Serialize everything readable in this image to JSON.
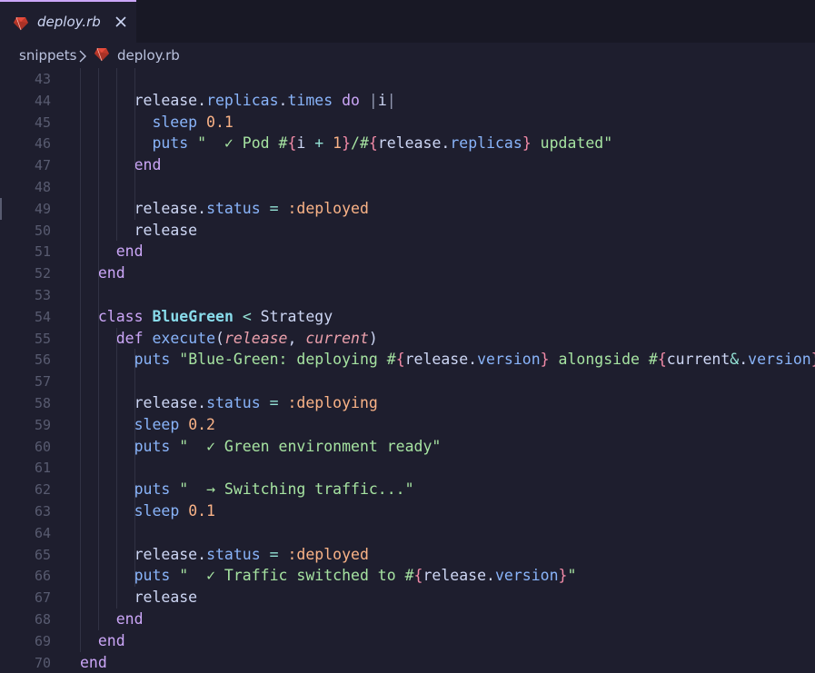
{
  "tab": {
    "label": "deploy.rb",
    "icon": "ruby-icon"
  },
  "breadcrumb": {
    "folder": "snippets",
    "file": "deploy.rb"
  },
  "colors": {
    "background": "#1e1e2e",
    "tabbar": "#181825",
    "keyword": "#cba6f7",
    "string": "#a6e3a1",
    "number": "#fab387",
    "class": "#89dceb",
    "property": "#89b4fa",
    "parameter": "#eba0ac",
    "line_number": "#585b70"
  },
  "lines": [
    {
      "n": "43",
      "indent": 0,
      "tokens": []
    },
    {
      "n": "44",
      "indent": 3,
      "tokens": [
        [
          "var",
          "release."
        ],
        [
          "prop",
          "replicas"
        ],
        [
          "var",
          "."
        ],
        [
          "prop",
          "times"
        ],
        [
          "var",
          " "
        ],
        [
          "kw",
          "do"
        ],
        [
          "var",
          " "
        ],
        [
          "pipe",
          "|"
        ],
        [
          "var",
          "i"
        ],
        [
          "pipe",
          "|"
        ]
      ]
    },
    {
      "n": "45",
      "indent": 4,
      "tokens": [
        [
          "fn",
          "sleep"
        ],
        [
          "var",
          " "
        ],
        [
          "num",
          "0.1"
        ]
      ]
    },
    {
      "n": "46",
      "indent": 4,
      "tokens": [
        [
          "fn",
          "puts"
        ],
        [
          "var",
          " "
        ],
        [
          "str",
          "\"  ✓ Pod #"
        ],
        [
          "interp",
          "{"
        ],
        [
          "var",
          "i "
        ],
        [
          "op",
          "+"
        ],
        [
          "var",
          " "
        ],
        [
          "num",
          "1"
        ],
        [
          "interp",
          "}"
        ],
        [
          "str",
          "/#"
        ],
        [
          "interp",
          "{"
        ],
        [
          "var",
          "release."
        ],
        [
          "prop",
          "replicas"
        ],
        [
          "interp",
          "}"
        ],
        [
          "str",
          " updated\""
        ]
      ]
    },
    {
      "n": "47",
      "indent": 3,
      "tokens": [
        [
          "kw",
          "end"
        ]
      ]
    },
    {
      "n": "48",
      "indent": 0,
      "tokens": []
    },
    {
      "n": "49",
      "indent": 3,
      "tokens": [
        [
          "var",
          "release."
        ],
        [
          "prop",
          "status"
        ],
        [
          "var",
          " "
        ],
        [
          "op",
          "="
        ],
        [
          "var",
          " "
        ],
        [
          "sym",
          ":deployed"
        ]
      ]
    },
    {
      "n": "50",
      "indent": 3,
      "tokens": [
        [
          "var",
          "release"
        ]
      ]
    },
    {
      "n": "51",
      "indent": 2,
      "tokens": [
        [
          "kw",
          "end"
        ]
      ]
    },
    {
      "n": "52",
      "indent": 1,
      "tokens": [
        [
          "kw",
          "end"
        ]
      ]
    },
    {
      "n": "53",
      "indent": 0,
      "tokens": []
    },
    {
      "n": "54",
      "indent": 1,
      "tokens": [
        [
          "kw",
          "class"
        ],
        [
          "var",
          " "
        ],
        [
          "cls",
          "BlueGreen"
        ],
        [
          "var",
          " "
        ],
        [
          "op",
          "<"
        ],
        [
          "var",
          " Strategy"
        ]
      ]
    },
    {
      "n": "55",
      "indent": 2,
      "tokens": [
        [
          "kw",
          "def"
        ],
        [
          "var",
          " "
        ],
        [
          "fn",
          "execute"
        ],
        [
          "var",
          "("
        ],
        [
          "param",
          "release"
        ],
        [
          "var",
          ", "
        ],
        [
          "param",
          "current"
        ],
        [
          "var",
          ")"
        ]
      ]
    },
    {
      "n": "56",
      "indent": 3,
      "tokens": [
        [
          "fn",
          "puts"
        ],
        [
          "var",
          " "
        ],
        [
          "str",
          "\"Blue-Green: deploying #"
        ],
        [
          "interp",
          "{"
        ],
        [
          "var",
          "release."
        ],
        [
          "prop",
          "version"
        ],
        [
          "interp",
          "}"
        ],
        [
          "str",
          " alongside #"
        ],
        [
          "interp",
          "{"
        ],
        [
          "var",
          "current"
        ],
        [
          "op",
          "&"
        ],
        [
          "var",
          "."
        ],
        [
          "prop",
          "version"
        ],
        [
          "interp",
          "}"
        ],
        [
          "str",
          "\""
        ]
      ]
    },
    {
      "n": "57",
      "indent": 0,
      "tokens": []
    },
    {
      "n": "58",
      "indent": 3,
      "tokens": [
        [
          "var",
          "release."
        ],
        [
          "prop",
          "status"
        ],
        [
          "var",
          " "
        ],
        [
          "op",
          "="
        ],
        [
          "var",
          " "
        ],
        [
          "sym",
          ":deploying"
        ]
      ]
    },
    {
      "n": "59",
      "indent": 3,
      "tokens": [
        [
          "fn",
          "sleep"
        ],
        [
          "var",
          " "
        ],
        [
          "num",
          "0.2"
        ]
      ]
    },
    {
      "n": "60",
      "indent": 3,
      "tokens": [
        [
          "fn",
          "puts"
        ],
        [
          "var",
          " "
        ],
        [
          "str",
          "\"  ✓ Green environment ready\""
        ]
      ]
    },
    {
      "n": "61",
      "indent": 0,
      "tokens": []
    },
    {
      "n": "62",
      "indent": 3,
      "tokens": [
        [
          "fn",
          "puts"
        ],
        [
          "var",
          " "
        ],
        [
          "str",
          "\"  → Switching traffic...\""
        ]
      ]
    },
    {
      "n": "63",
      "indent": 3,
      "tokens": [
        [
          "fn",
          "sleep"
        ],
        [
          "var",
          " "
        ],
        [
          "num",
          "0.1"
        ]
      ]
    },
    {
      "n": "64",
      "indent": 0,
      "tokens": []
    },
    {
      "n": "65",
      "indent": 3,
      "tokens": [
        [
          "var",
          "release."
        ],
        [
          "prop",
          "status"
        ],
        [
          "var",
          " "
        ],
        [
          "op",
          "="
        ],
        [
          "var",
          " "
        ],
        [
          "sym",
          ":deployed"
        ]
      ]
    },
    {
      "n": "66",
      "indent": 3,
      "tokens": [
        [
          "fn",
          "puts"
        ],
        [
          "var",
          " "
        ],
        [
          "str",
          "\"  ✓ Traffic switched to #"
        ],
        [
          "interp",
          "{"
        ],
        [
          "var",
          "release."
        ],
        [
          "prop",
          "version"
        ],
        [
          "interp",
          "}"
        ],
        [
          "str",
          "\""
        ]
      ]
    },
    {
      "n": "67",
      "indent": 3,
      "tokens": [
        [
          "var",
          "release"
        ]
      ]
    },
    {
      "n": "68",
      "indent": 2,
      "tokens": [
        [
          "kw",
          "end"
        ]
      ]
    },
    {
      "n": "69",
      "indent": 1,
      "tokens": [
        [
          "kw",
          "end"
        ]
      ]
    },
    {
      "n": "70",
      "indent": 0,
      "tokens": [
        [
          "kw",
          "end"
        ]
      ]
    }
  ]
}
